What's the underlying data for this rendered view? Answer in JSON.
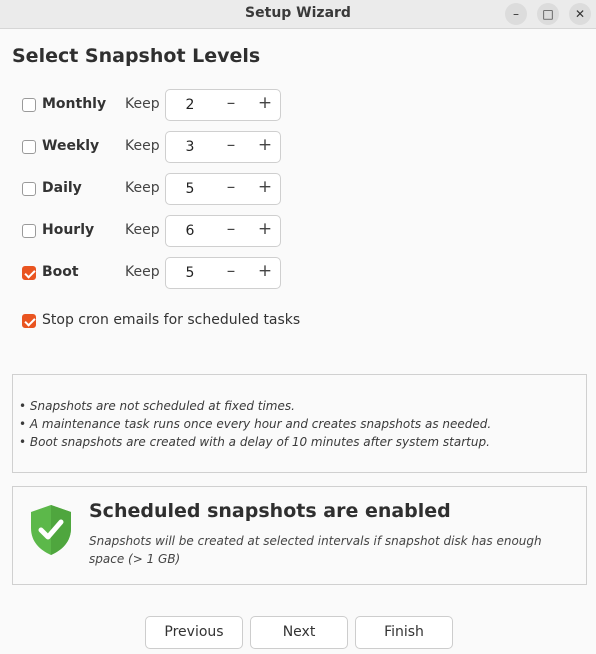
{
  "window": {
    "title": "Setup Wizard",
    "controls": {
      "minimize": "–",
      "maximize": "□",
      "close": "✕"
    }
  },
  "heading": "Select Snapshot Levels",
  "keep_label": "Keep",
  "levels": [
    {
      "label": "Monthly",
      "checked": false,
      "value": "2"
    },
    {
      "label": "Weekly",
      "checked": false,
      "value": "3"
    },
    {
      "label": "Daily",
      "checked": false,
      "value": "5"
    },
    {
      "label": "Hourly",
      "checked": false,
      "value": "6"
    },
    {
      "label": "Boot",
      "checked": true,
      "value": "5"
    }
  ],
  "spin": {
    "minus": "–",
    "plus": "+"
  },
  "cron": {
    "label": "Stop cron emails for scheduled tasks",
    "checked": true
  },
  "notes": [
    "• Snapshots are not scheduled at fixed times.",
    "• A maintenance task runs once every hour and creates snapshots as needed.",
    "• Boot snapshots are created with a delay of 10 minutes after system startup."
  ],
  "status": {
    "title": "Scheduled snapshots are enabled",
    "description": "Snapshots will be created at selected intervals if snapshot disk has enough space (> 1 GB)",
    "icon": "shield-check-icon",
    "color": "#5cb84a"
  },
  "buttons": {
    "previous": "Previous",
    "next": "Next",
    "finish": "Finish"
  },
  "colors": {
    "accent": "#e95420"
  }
}
